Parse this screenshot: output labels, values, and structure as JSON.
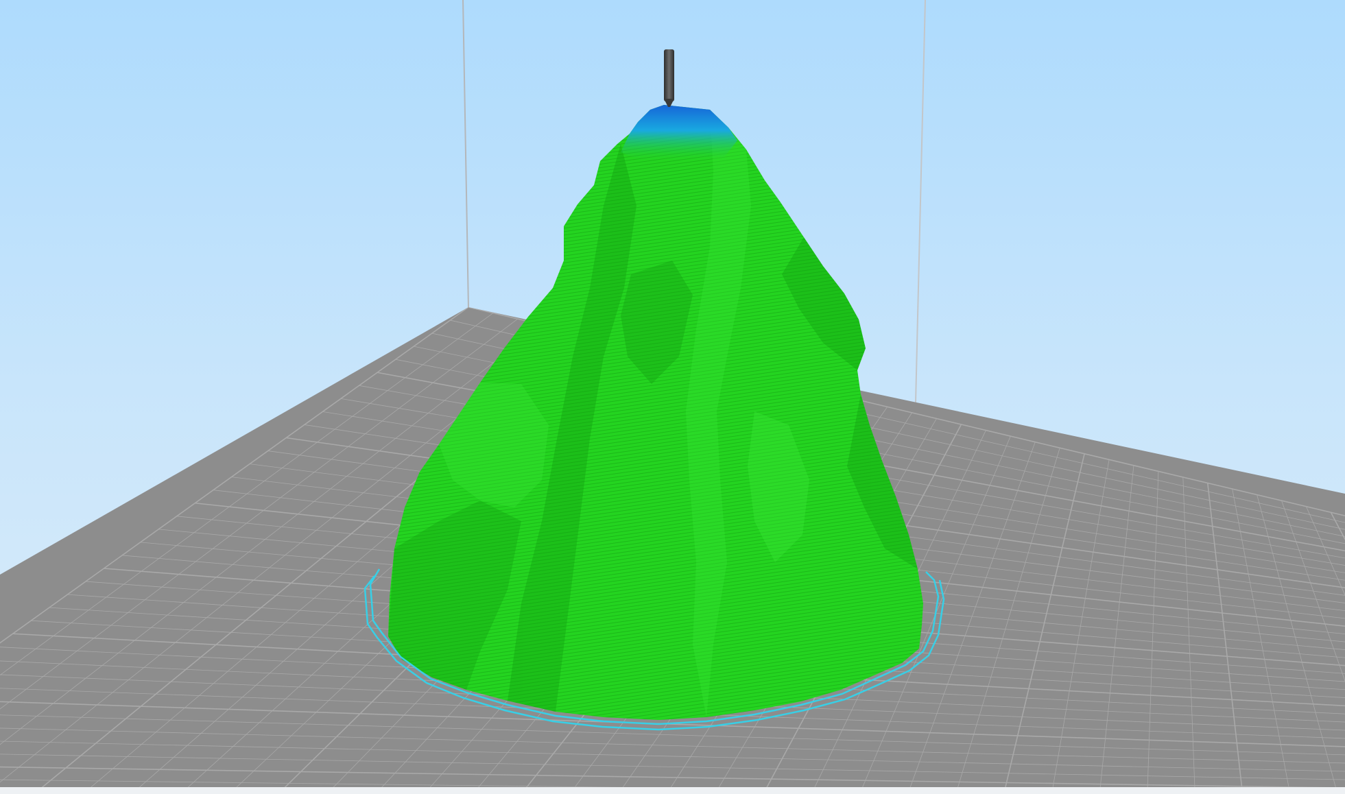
{
  "viewport": {
    "view": "layer-view",
    "colors": {
      "sky_top": "#aedbfd",
      "sky_bottom": "#dcecf8",
      "build_plate": "#8c8c8c",
      "grid_line": "#a9a9a9",
      "build_volume_edge": "#b5b5b5",
      "model_body": "#22d41f",
      "model_top_layers": "#1a87e0",
      "skirt": "#3ad3e8",
      "nozzle": "#444444"
    },
    "icons": {
      "nozzle": "print-head-nozzle-icon"
    }
  }
}
